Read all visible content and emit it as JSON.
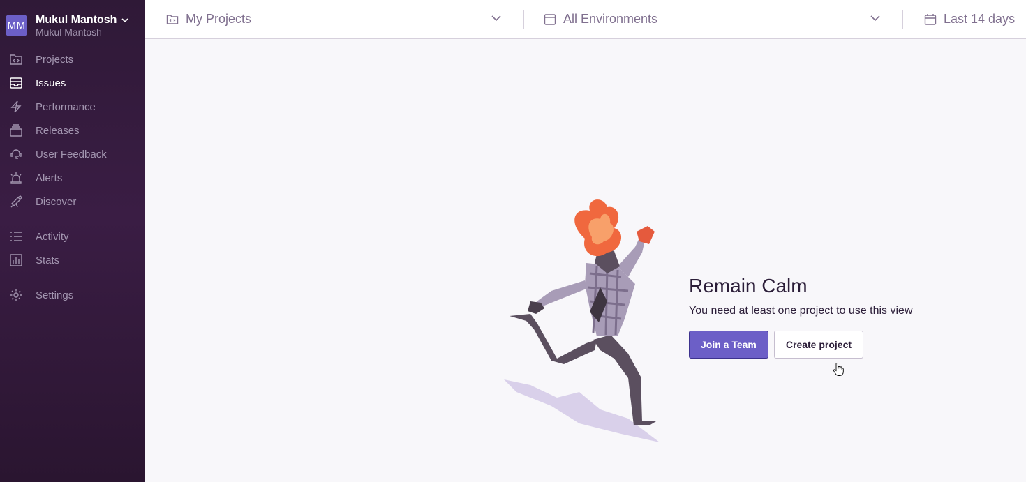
{
  "org": {
    "initials": "MM",
    "name": "Mukul Mantosh",
    "subname": "Mukul Mantosh"
  },
  "sidebar": {
    "items": [
      {
        "label": "Projects",
        "icon": "projects-icon"
      },
      {
        "label": "Issues",
        "icon": "issues-icon",
        "active": true
      },
      {
        "label": "Performance",
        "icon": "performance-icon"
      },
      {
        "label": "Releases",
        "icon": "releases-icon"
      },
      {
        "label": "User Feedback",
        "icon": "user-feedback-icon"
      },
      {
        "label": "Alerts",
        "icon": "alerts-icon"
      },
      {
        "label": "Discover",
        "icon": "discover-icon"
      },
      {
        "label": "Activity",
        "icon": "activity-icon"
      },
      {
        "label": "Stats",
        "icon": "stats-icon"
      },
      {
        "label": "Settings",
        "icon": "settings-icon"
      }
    ]
  },
  "topbar": {
    "projects": "My Projects",
    "environments": "All Environments",
    "date_range": "Last 14 days"
  },
  "empty_state": {
    "title": "Remain Calm",
    "message": "You need at least one project to use this view",
    "join_team": "Join a Team",
    "create_project": "Create project"
  },
  "colors": {
    "accent": "#6c5fc7",
    "sidebar_bg": "#2f1937",
    "page_bg": "#f8f7fa"
  }
}
